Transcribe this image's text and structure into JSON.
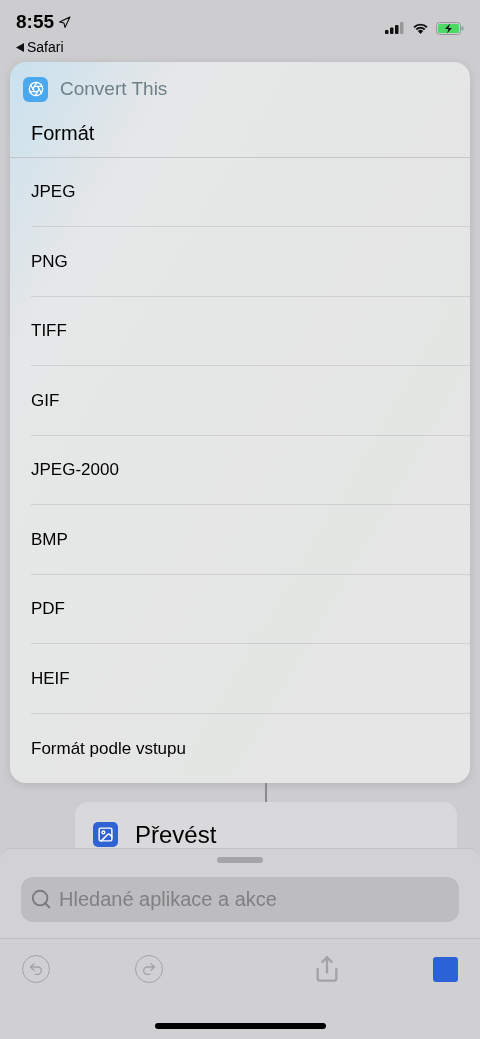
{
  "status_bar": {
    "time": "8:55",
    "back_label": "Safari"
  },
  "popup": {
    "app_name": "Convert This",
    "title": "Formát",
    "options": [
      {
        "label": "JPEG"
      },
      {
        "label": "PNG"
      },
      {
        "label": "TIFF"
      },
      {
        "label": "GIF"
      },
      {
        "label": "JPEG-2000"
      },
      {
        "label": "BMP"
      },
      {
        "label": "PDF"
      },
      {
        "label": "HEIF"
      },
      {
        "label": "Formát podle vstupu"
      }
    ]
  },
  "action_card": {
    "title": "Převést"
  },
  "search": {
    "placeholder": "Hledané aplikace a akce"
  }
}
